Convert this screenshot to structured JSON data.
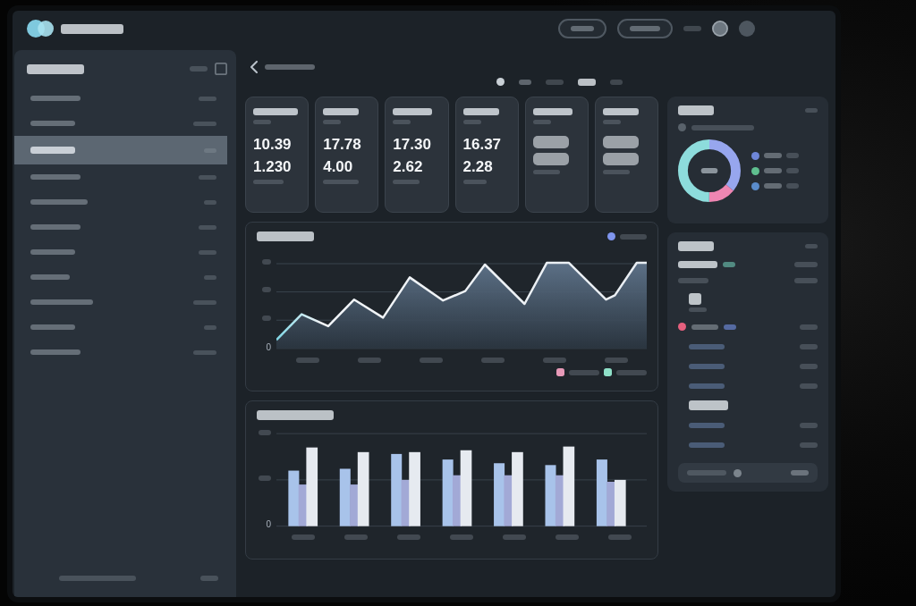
{
  "sidebar": {
    "items": [
      {
        "selected": false
      },
      {
        "selected": false
      },
      {
        "selected": true
      },
      {
        "selected": false
      },
      {
        "selected": false
      },
      {
        "selected": false
      },
      {
        "selected": false
      },
      {
        "selected": false
      },
      {
        "selected": false
      },
      {
        "selected": false
      },
      {
        "selected": false
      }
    ]
  },
  "stat_cards": [
    {
      "legible": true,
      "value": "10.39",
      "secondary_value": "1.230"
    },
    {
      "legible": true,
      "value": "17.78",
      "secondary_value": "4.00"
    },
    {
      "legible": true,
      "value": "17.30",
      "secondary_value": "2.62"
    },
    {
      "legible": true,
      "value": "16.37",
      "secondary_value": "2.28"
    },
    {
      "legible": false
    },
    {
      "legible": false
    }
  ],
  "line_chart": {
    "legend": [
      {
        "color": "#7f95ee"
      }
    ],
    "y_axis_base_label": "0",
    "bottom_legend": [
      {
        "color": "#e79ab8"
      },
      {
        "color": "#8fe0c8"
      }
    ]
  },
  "bar_chart": {
    "y_axis_base_label": "0"
  },
  "donut_card": {
    "legend": [
      {
        "color": "#6e86d8"
      },
      {
        "color": "#5fbf8f"
      },
      {
        "color": "#5a8ccc"
      }
    ]
  },
  "activity_panel": {
    "rows": [
      {
        "kind": "status",
        "color": "#e6607e"
      },
      {
        "kind": "item"
      },
      {
        "kind": "item"
      },
      {
        "kind": "item"
      },
      {
        "kind": "heading"
      },
      {
        "kind": "item"
      },
      {
        "kind": "item"
      }
    ]
  }
}
